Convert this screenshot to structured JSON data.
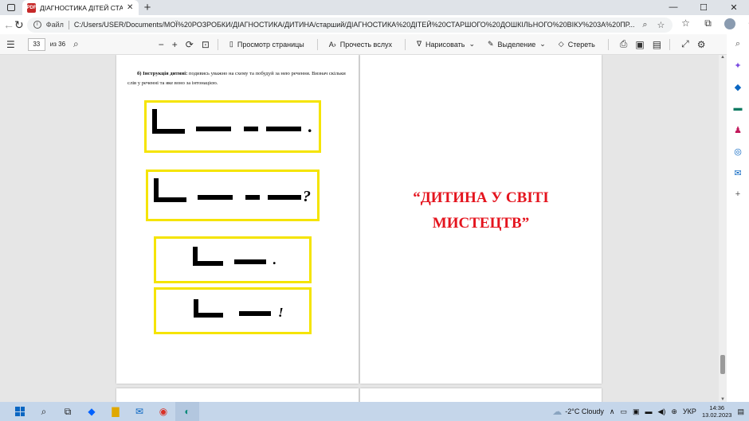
{
  "tab": {
    "title": "ДІАГНОСТИКА ДІТЕЙ СТАРШОГО",
    "close": "✕",
    "new_tab": "+"
  },
  "window_controls": {
    "minimize": "—",
    "restore": "☐",
    "close": "✕"
  },
  "address_bar": {
    "scheme_label": "Файл",
    "url": "C:/Users/USER/Documents/МОЇ%20РОЗРОБКИ/ДІАГНОСТИКА/ДИТИНА/старший/ДІАГНОСТИКА%20ДІТЕЙ%20СТАРШОГО%20ДОШКІЛЬНОГО%20ВІКУ%203А%20ПР..."
  },
  "pdf_toolbar": {
    "page_number": "33",
    "page_count": "из 36",
    "view_page": "Просмотр страницы",
    "read_aloud": "Прочесть вслух",
    "draw": "Нарисовать",
    "highlight": "Выделение",
    "erase": "Стереть"
  },
  "document": {
    "instruction_bold": "б) Інструкція дитині:",
    "instruction_text": " подивись уважно на схему та побудуй за нею речення. Визнач скільки слів у реченні та яке воно за інтонацією.",
    "title_line1": "“ДИТИНА У СВІТІ",
    "title_line2": "МИСТЕЦТВ”",
    "scheme_marks": [
      ".",
      "?",
      ".",
      "!"
    ]
  },
  "taskbar": {
    "weather": "-2°C  Cloudy",
    "language": "УКР",
    "time": "14:36",
    "date": "13.02.2023"
  },
  "colors": {
    "title_red": "#e4141e",
    "scheme_border": "#f5e400"
  }
}
